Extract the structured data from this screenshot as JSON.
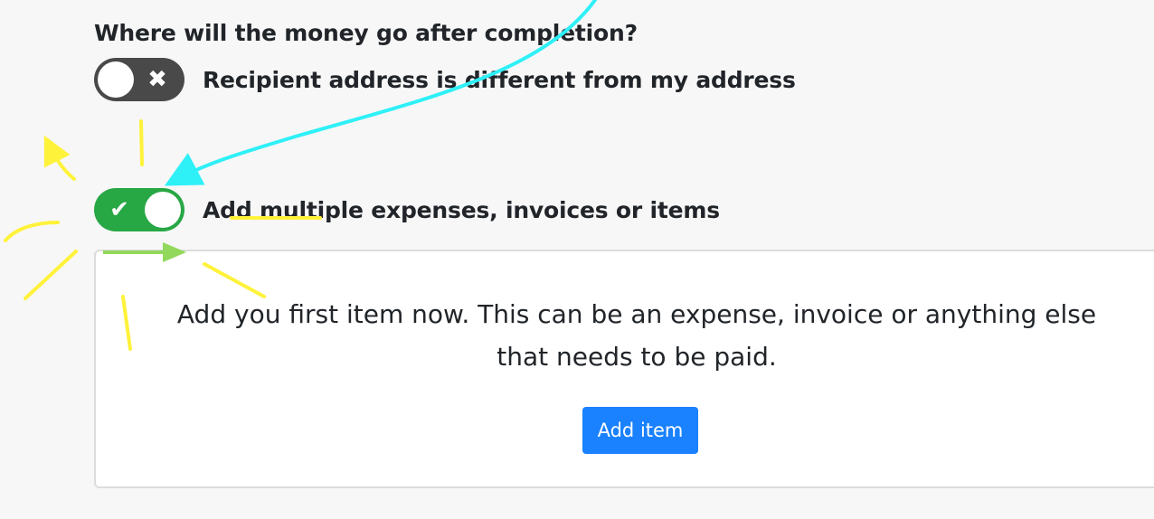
{
  "form": {
    "question": "Where will the money go after completion?",
    "recipient_toggle": {
      "label": "Recipient address is different from my address",
      "state": "off",
      "icon": "close-icon",
      "glyph": "✖"
    },
    "multiple_toggle": {
      "label": "Add multiple expenses, invoices or items",
      "state": "on",
      "icon": "check-icon",
      "glyph": "✔"
    }
  },
  "items_card": {
    "message_line1": "Add you first item now. This can be an expense, invoice or anything else",
    "message_line2": "that needs to be paid.",
    "add_button_label": "Add item"
  },
  "colors": {
    "toggle_off": "#494949",
    "toggle_on": "#28a745",
    "button_primary": "#1a81ff",
    "annotation_cyan": "#2ef0f7",
    "annotation_yellow": "#fff23a",
    "annotation_green": "#92d85a"
  }
}
